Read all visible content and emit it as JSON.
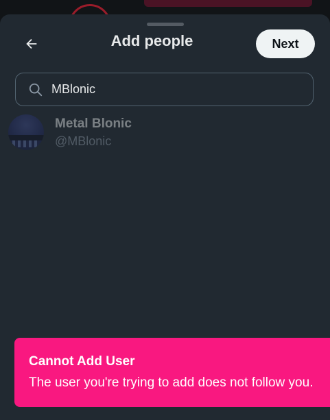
{
  "header": {
    "title": "Add people",
    "next_label": "Next",
    "back_icon": "arrow-left-icon"
  },
  "search": {
    "value": "MBlonic",
    "icon": "search-icon"
  },
  "results": [
    {
      "display_name": "Metal Blonic",
      "handle": "@MBlonic"
    }
  ],
  "toast": {
    "title": "Cannot Add User",
    "message": "The user you're trying to add does not follow you."
  },
  "colors": {
    "sheet_background": "#212931",
    "toast_background": "#f91880",
    "text_primary": "#e7e9ea",
    "text_secondary": "#8b98a5",
    "button_background": "#eff3f4"
  }
}
